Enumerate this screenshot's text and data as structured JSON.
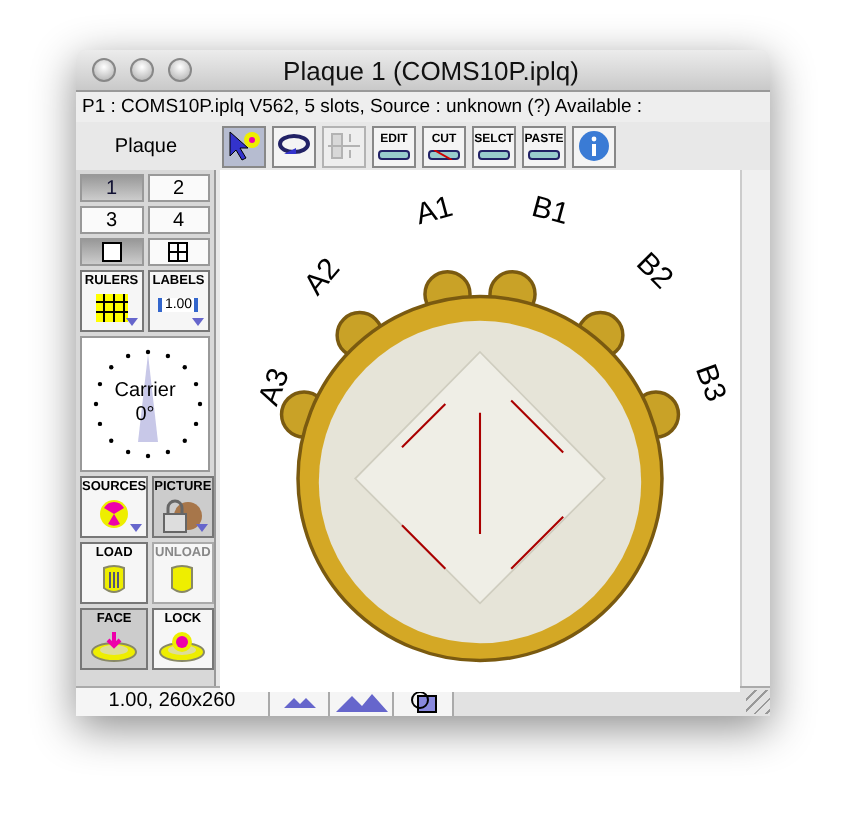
{
  "window": {
    "title": "Plaque 1 (COMS10P.iplq)"
  },
  "info_line": "P1 : COMS10P.iplq V562, 5 slots, Source : unknown (?) Available :",
  "toolbar": {
    "label": "Plaque",
    "tools": [
      {
        "kind": "pointer",
        "selected": true,
        "disabled": false
      },
      {
        "kind": "rotate",
        "selected": false,
        "disabled": false
      },
      {
        "kind": "align",
        "selected": false,
        "disabled": true
      },
      {
        "kind": "text",
        "label": "EDIT",
        "selected": false,
        "disabled": false
      },
      {
        "kind": "cut",
        "label": "CUT",
        "selected": false,
        "disabled": false
      },
      {
        "kind": "text",
        "label": "SELCT",
        "selected": false,
        "disabled": false
      },
      {
        "kind": "text",
        "label": "PASTE",
        "selected": false,
        "disabled": false
      },
      {
        "kind": "info",
        "selected": false,
        "disabled": false
      }
    ]
  },
  "pages": [
    {
      "label": "1",
      "selected": true
    },
    {
      "label": "2",
      "selected": false
    },
    {
      "label": "3",
      "selected": false
    },
    {
      "label": "4",
      "selected": false
    }
  ],
  "views": [
    {
      "kind": "single",
      "selected": true
    },
    {
      "kind": "grid",
      "selected": false
    }
  ],
  "tiles_top": [
    {
      "kind": "rulers",
      "label": "RULERS",
      "selected": false,
      "disabled": false
    },
    {
      "kind": "labels",
      "label": "LABELS",
      "value": "1.00",
      "selected": false,
      "disabled": false
    }
  ],
  "dial": {
    "label": "Carrier",
    "angle": "0°"
  },
  "tiles_bottom": [
    {
      "kind": "sources",
      "label": "SOURCES",
      "selected": false,
      "disabled": false
    },
    {
      "kind": "picture",
      "label": "PICTURE",
      "selected": true,
      "disabled": false
    },
    {
      "kind": "load",
      "label": "LOAD",
      "selected": false,
      "disabled": false
    },
    {
      "kind": "load",
      "label": "UNLOAD",
      "selected": false,
      "disabled": true
    },
    {
      "kind": "face",
      "label": "FACE",
      "selected": true,
      "disabled": false
    },
    {
      "kind": "lock",
      "label": "LOCK",
      "selected": false,
      "disabled": false
    }
  ],
  "slots": [
    {
      "label": "A3"
    },
    {
      "label": "A2"
    },
    {
      "label": "A1"
    },
    {
      "label": "B1"
    },
    {
      "label": "B2"
    },
    {
      "label": "B3"
    }
  ],
  "status_bar": {
    "zoom": "1.00, 260x260",
    "buttons": [
      {
        "kind": "zoom-out"
      },
      {
        "kind": "zoom-in"
      },
      {
        "kind": "fit"
      }
    ]
  }
}
